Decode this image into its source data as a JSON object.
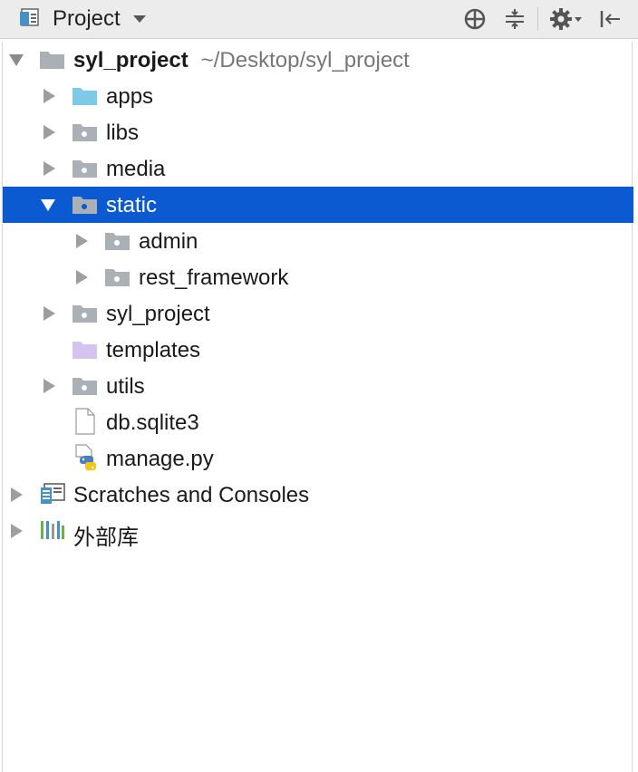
{
  "toolbar": {
    "title": "Project",
    "icons": [
      "project-view-icon",
      "dropdown-caret-icon",
      "locate-icon",
      "collapse-all-icon",
      "gear-icon",
      "hide-panel-icon"
    ]
  },
  "tree": [
    {
      "label": "syl_project",
      "path": "~/Desktop/syl_project",
      "icon": "module-folder-icon",
      "expanded": true
    },
    {
      "label": "apps",
      "icon": "folder-blue-icon"
    },
    {
      "label": "libs",
      "icon": "package-folder-icon"
    },
    {
      "label": "media",
      "icon": "package-folder-icon"
    },
    {
      "label": "static",
      "icon": "package-folder-icon",
      "expanded": true,
      "selected": true
    },
    {
      "label": "admin",
      "icon": "package-folder-icon"
    },
    {
      "label": "rest_framework",
      "icon": "package-folder-icon"
    },
    {
      "label": "syl_project",
      "icon": "package-folder-icon"
    },
    {
      "label": "templates",
      "icon": "templates-folder-icon"
    },
    {
      "label": "utils",
      "icon": "package-folder-icon"
    },
    {
      "label": "db.sqlite3",
      "icon": "file-icon"
    },
    {
      "label": "manage.py",
      "icon": "python-file-icon"
    },
    {
      "label": "Scratches and Consoles",
      "icon": "scratches-icon"
    },
    {
      "label": "外部库",
      "icon": "external-libraries-icon"
    }
  ],
  "colors": {
    "selection": "#0b5ad1",
    "folder_gray": "#aab0b6",
    "folder_blue": "#7ec8e8",
    "folder_purple": "#d6c4f0"
  }
}
